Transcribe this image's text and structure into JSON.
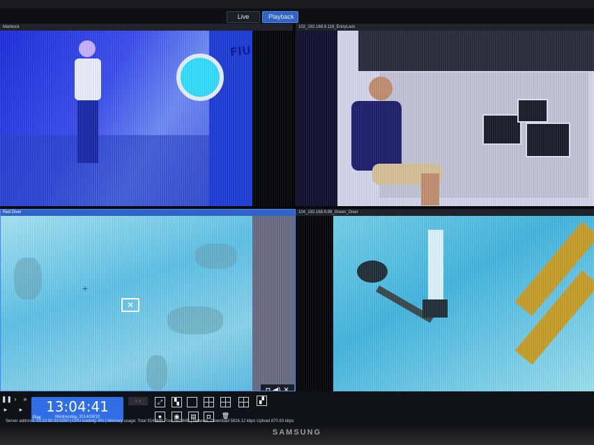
{
  "tabs": {
    "live_view": "Live View",
    "playback": "Playback"
  },
  "panes": [
    {
      "title": "Mainlock"
    },
    {
      "title": "102_192.168.9.119_EntryLock"
    },
    {
      "title": "Red Diver"
    },
    {
      "title": "104_192.168.9.89_Green_Diver"
    }
  ],
  "scene": {
    "logo_text": "FIU"
  },
  "clock": {
    "time": "13:04:41",
    "date": "Wednesday, 2014/09/10",
    "play_label": "Play"
  },
  "status": {
    "server": "Server address: 10.10.90.33:5250",
    "cpu": "CPU loading: 6%",
    "memory": "Memory usage: Total 8149MB  Free 5823MB",
    "network": "Network: Download  5826.12 kbps Upload   870.63 kbps"
  },
  "brand": "SAMSUNG",
  "icons": [
    "crosshair-icon",
    "no-video-icon",
    "snapshot-icon",
    "audio-icon",
    "tools-icon",
    "play-icon",
    "pause-icon",
    "layout-icon",
    "trash-icon"
  ]
}
